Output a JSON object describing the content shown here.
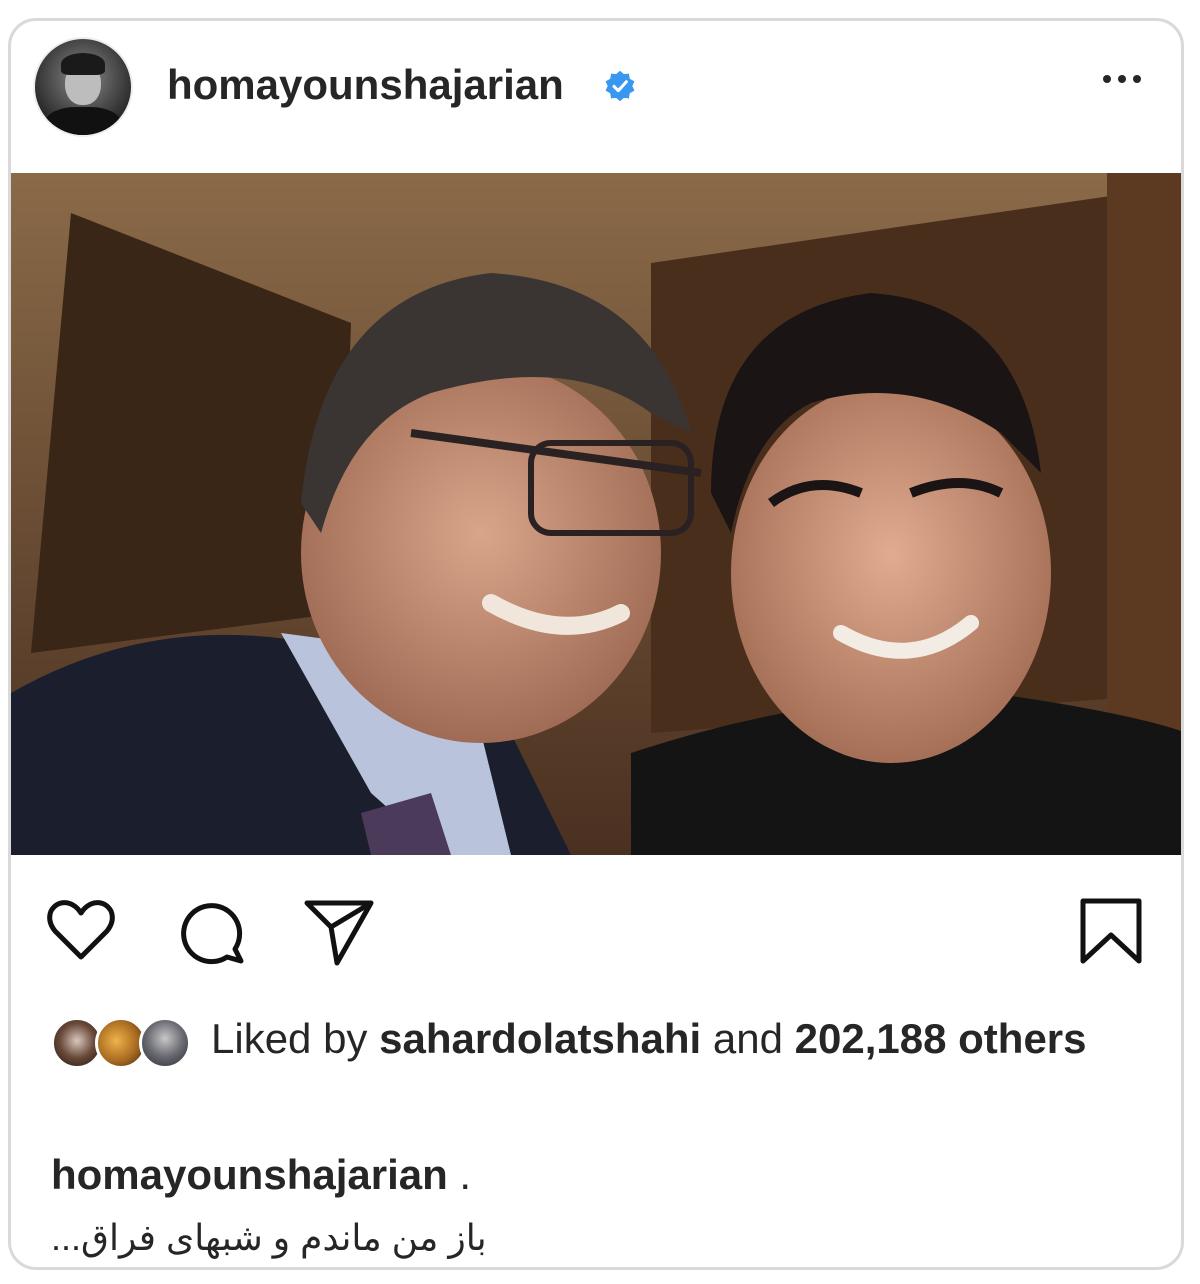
{
  "header": {
    "username": "homayounshajarian",
    "verified": true,
    "more_icon": "more-horizontal-icon"
  },
  "photo": {
    "alt": "Photo"
  },
  "actions": {
    "like_icon": "heart-icon",
    "comment_icon": "comment-icon",
    "share_icon": "send-icon",
    "save_icon": "bookmark-icon"
  },
  "likes": {
    "prefix": "Liked by",
    "user": "sahardolatshahi",
    "connector": "and",
    "count": "202,188",
    "suffix": "others"
  },
  "caption": {
    "username": "homayounshajarian",
    "after_username": " .",
    "text": "باز من ماندم و شبهای فراق..."
  },
  "colors": {
    "verified": "#3897f0",
    "text": "#262626",
    "border": "#d9d9d9"
  }
}
